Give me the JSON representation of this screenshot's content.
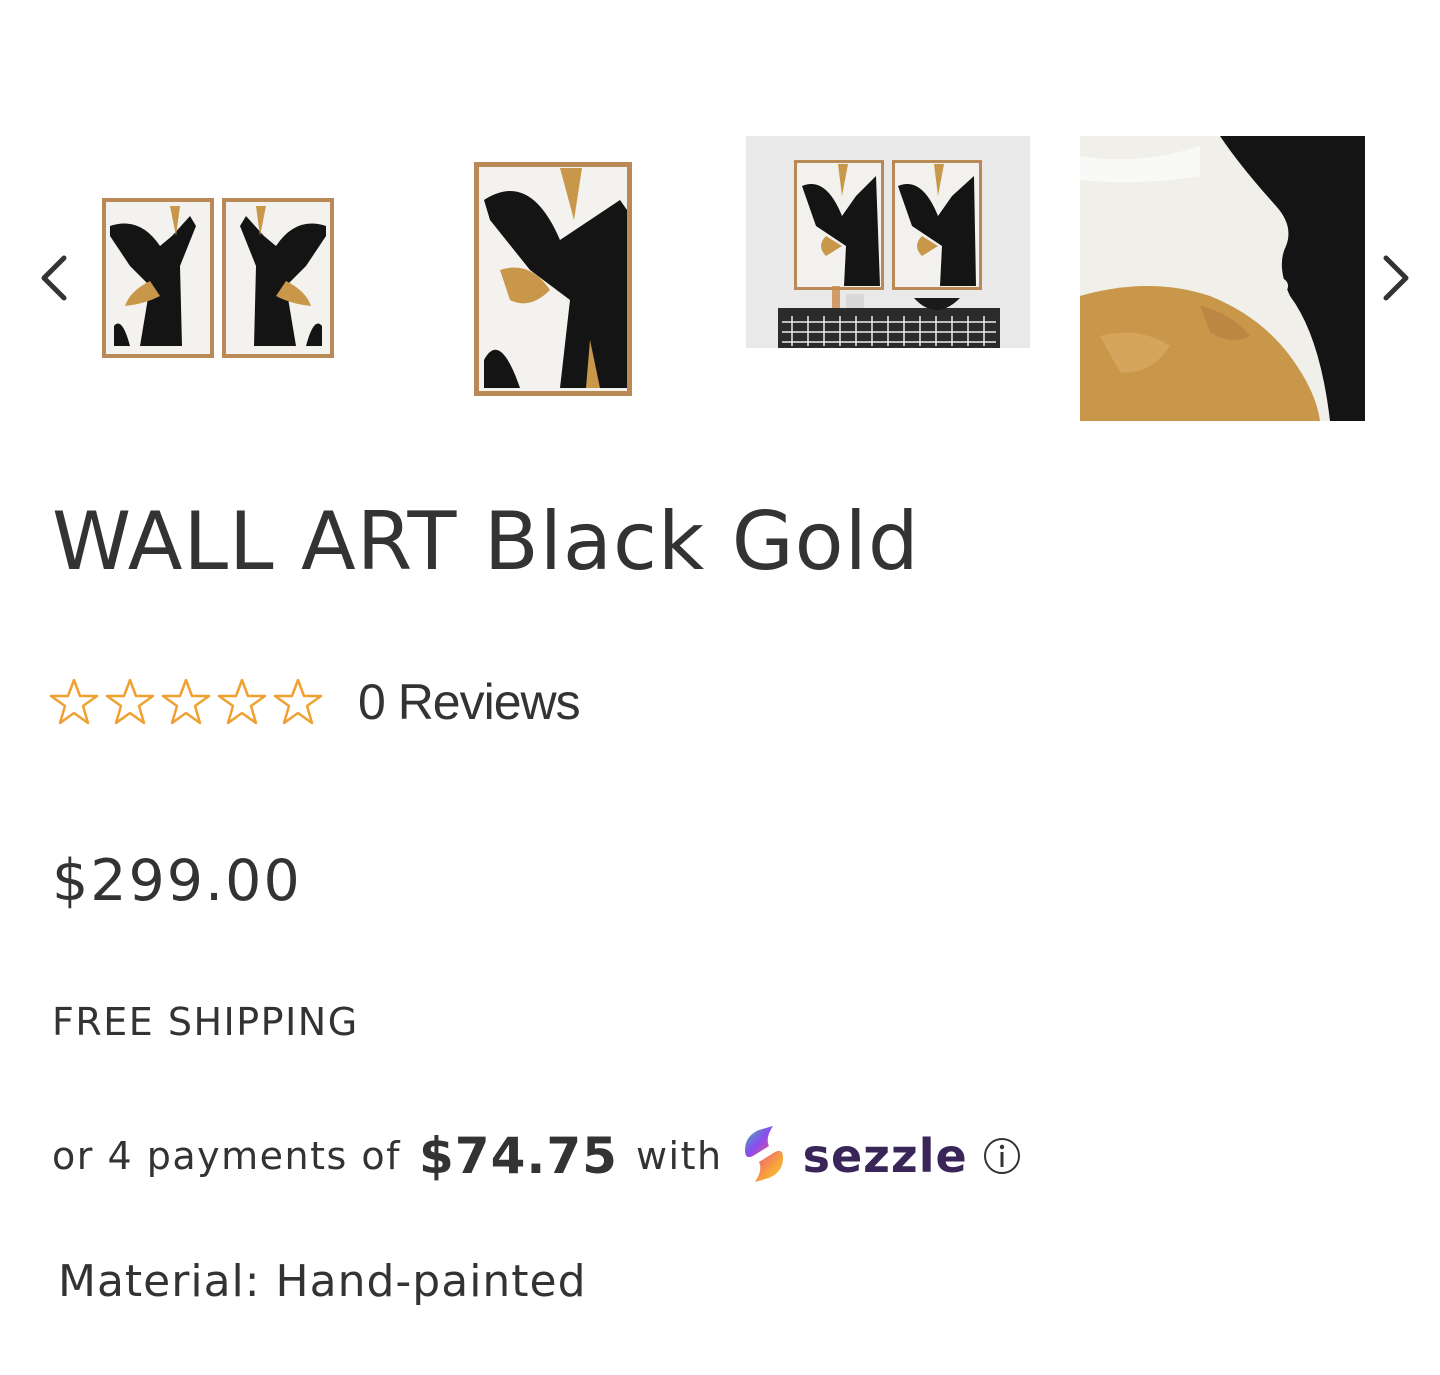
{
  "carousel": {
    "prev_icon": "chevron-left-icon",
    "next_icon": "chevron-right-icon",
    "thumbnails": [
      {
        "name": "thumbnail-diptych-pair"
      },
      {
        "name": "thumbnail-single-panel"
      },
      {
        "name": "thumbnail-room-scene"
      },
      {
        "name": "thumbnail-texture-closeup"
      }
    ]
  },
  "product": {
    "title": "WALL ART Black Gold",
    "rating": {
      "stars_filled": 0,
      "stars_total": 5,
      "star_icon": "star-outline-icon",
      "star_color": "#F0A030",
      "reviews_label": "0 Reviews"
    },
    "price": "$299.00",
    "shipping": "FREE SHIPPING",
    "installments": {
      "prefix": "or 4 payments of",
      "amount": "$74.75",
      "suffix": "with",
      "provider": "sezzle",
      "provider_color": "#392558",
      "info_icon": "info-icon"
    },
    "material": "Material: Hand-painted"
  },
  "colors": {
    "text": "#333333",
    "background": "#FFFFFF",
    "gold": "#C9974A",
    "black": "#111111"
  }
}
